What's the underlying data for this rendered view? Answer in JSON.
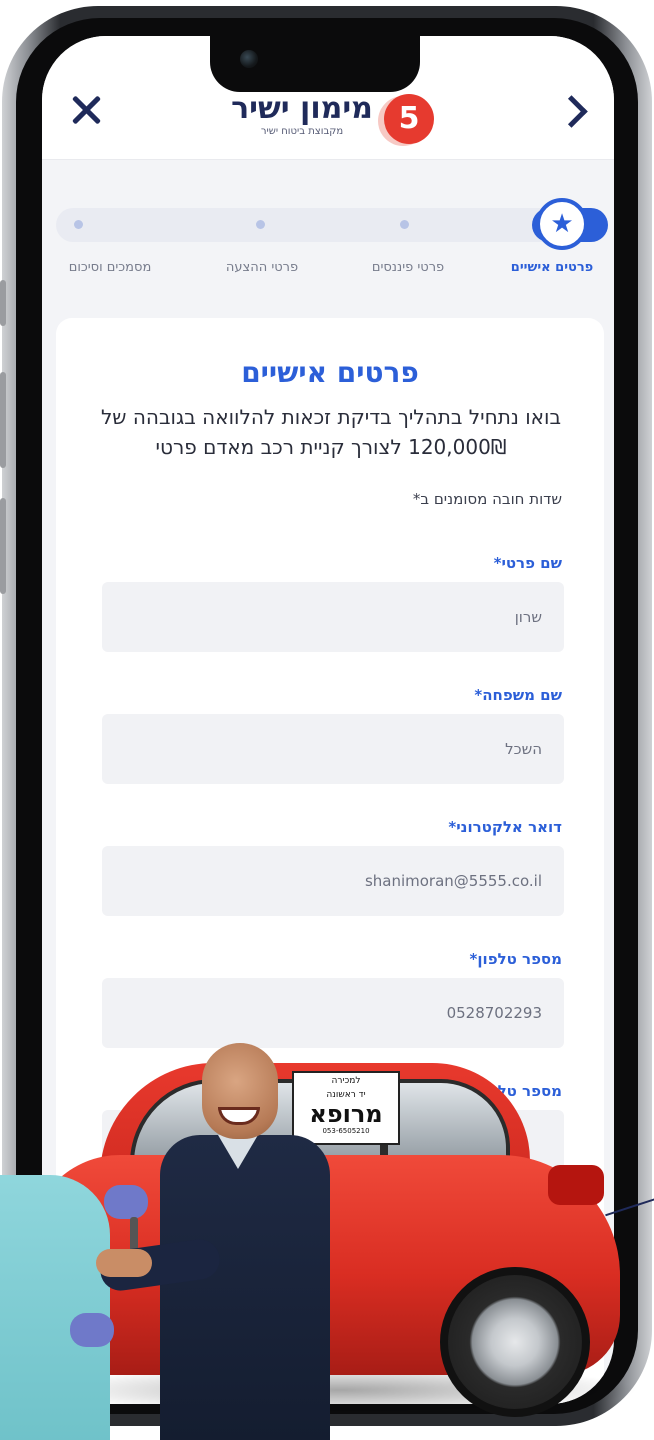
{
  "header": {
    "brand_name": "מימון ישיר",
    "brand_tagline": "מקבוצת ביטוח ישיר",
    "brand_badge": "5"
  },
  "stepper": {
    "steps": [
      {
        "label": "פרטים אישיים",
        "active": true
      },
      {
        "label": "פרטי פיננסים",
        "active": false
      },
      {
        "label": "פרטי ההצעה",
        "active": false
      },
      {
        "label": "מסמכים וסיכום",
        "active": false
      }
    ],
    "active_icon": "star-icon"
  },
  "form": {
    "title": "פרטים אישיים",
    "intro": "בואו נתחיל בתהליך בדיקת זכאות להלוואה בגובהה של 120,000₪ לצורך קניית רכב מאדם פרטי",
    "required_note": "שדות חובה מסומנים ב*",
    "fields": [
      {
        "label": "שם פרטי*",
        "value": "שרון"
      },
      {
        "label": "שם משפחה*",
        "value": "השכל"
      },
      {
        "label": "דואר אלקטרוני*",
        "value": "shanimoran@5555.co.il"
      },
      {
        "label": "מספר טלפון*",
        "value": "0528702293"
      },
      {
        "label": "מספר טל",
        "value": ""
      }
    ]
  },
  "ad": {
    "sign_top": "למכירה",
    "sign_sub": "יד ראשונה",
    "sign_main": "מרופא",
    "sign_phone": "053-6505210"
  },
  "colors": {
    "accent": "#2c5fd8",
    "navy": "#1f2a5a",
    "brand_red": "#e63a2f",
    "car_red": "#d92d22",
    "input_bg": "#f1f2f5"
  }
}
